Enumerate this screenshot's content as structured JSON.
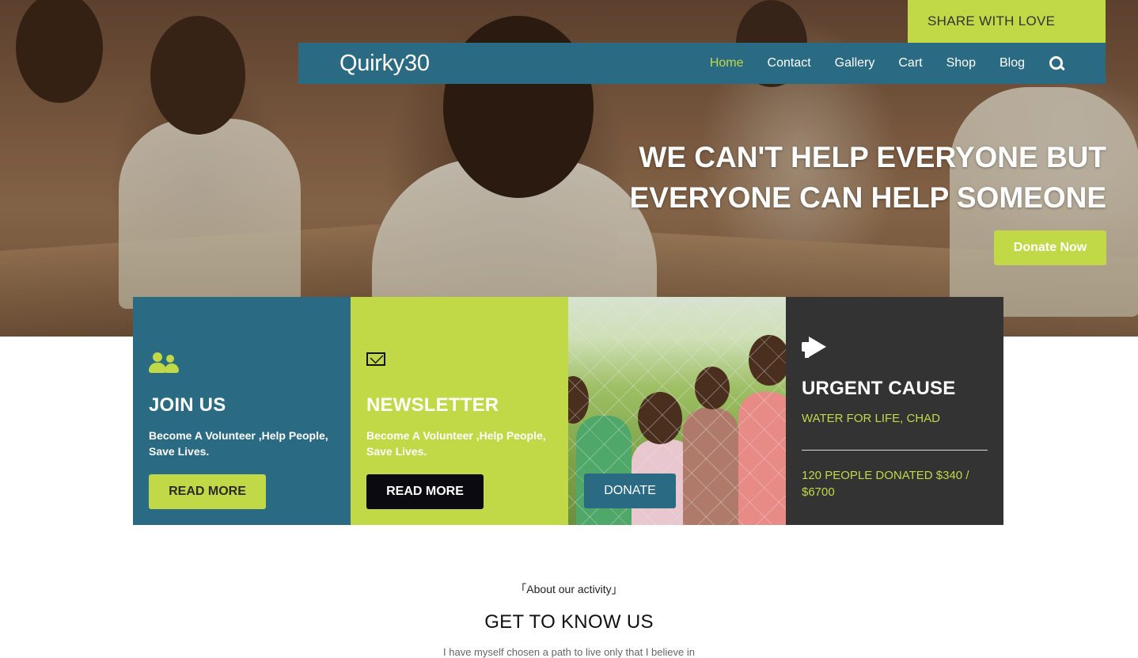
{
  "topbar": {
    "share_label": "SHARE WITH LOVE"
  },
  "brand": {
    "name": "Quirky30"
  },
  "nav": {
    "items": [
      {
        "label": "Home",
        "active": true
      },
      {
        "label": "Contact"
      },
      {
        "label": "Gallery"
      },
      {
        "label": "Cart"
      },
      {
        "label": "Shop"
      },
      {
        "label": "Blog"
      }
    ],
    "search_icon": "search-icon"
  },
  "hero": {
    "headline_line1": "WE CAN'T HELP EVERYONE BUT",
    "headline_line2": "EVERYONE CAN HELP SOMEONE",
    "cta_label": "Donate Now"
  },
  "cards": {
    "join": {
      "icon": "users-icon",
      "title": "JOIN US",
      "line1": "Become A Volunteer ,Help People,",
      "line2": "Save Lives.",
      "button": "READ MORE"
    },
    "newsletter": {
      "icon": "envelope-icon",
      "title": "NEWSLETTER",
      "line1": "Become A Volunteer ,Help People,",
      "line2": "Save Lives.",
      "button": "READ MORE"
    },
    "photo": {
      "button": "DONATE"
    },
    "urgent": {
      "icon": "megaphone-icon",
      "title": "URGENT CAUSE",
      "subtitle": "WATER FOR LIFE, CHAD",
      "stat_line1": "120 PEOPLE DONATED $340 /",
      "stat_line2": "$6700"
    }
  },
  "about": {
    "kicker": "「About our activity」",
    "title": "GET TO KNOW US",
    "text": "I have myself chosen a path to live only that I believe in"
  },
  "colors": {
    "accent_green": "#c1d947",
    "brand_blue": "#2b6a83",
    "dark": "#333333"
  }
}
